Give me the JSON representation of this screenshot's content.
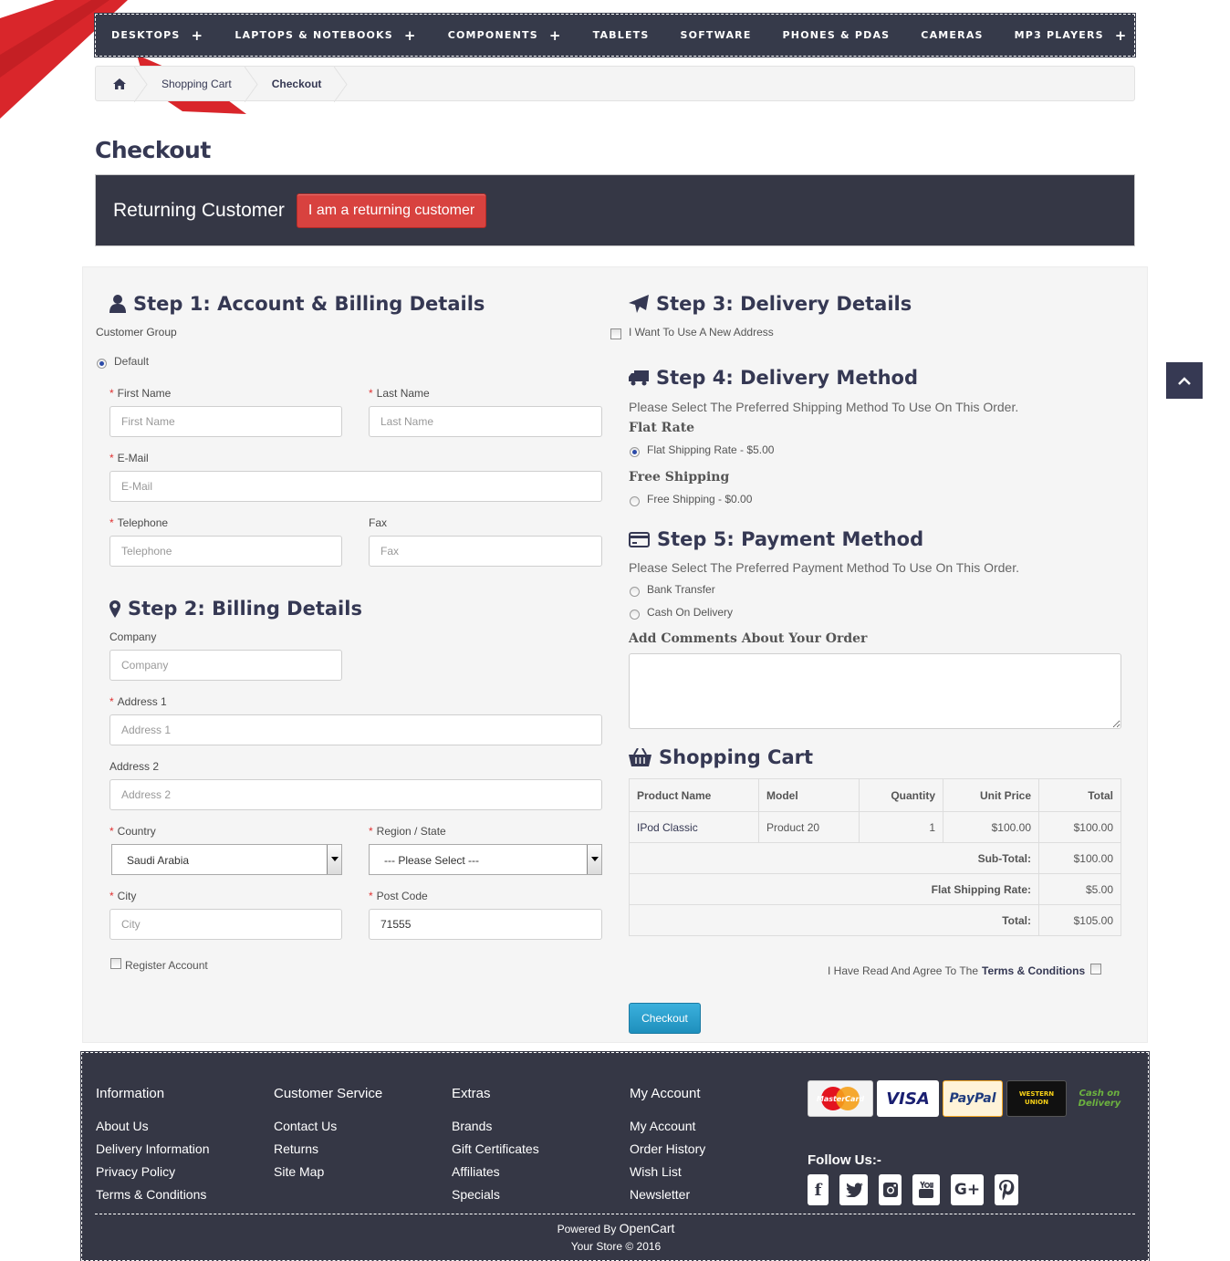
{
  "nav": {
    "items": [
      {
        "label": "DESKTOPS",
        "plus": "+"
      },
      {
        "label": "LAPTOPS & NOTEBOOKS",
        "plus": "+"
      },
      {
        "label": "COMPONENTS",
        "plus": "+"
      },
      {
        "label": "TABLETS",
        "plus": ""
      },
      {
        "label": "SOFTWARE",
        "plus": ""
      },
      {
        "label": "PHONES & PDAS",
        "plus": ""
      },
      {
        "label": "CAMERAS",
        "plus": ""
      },
      {
        "label": "MP3 PLAYERS",
        "plus": "+"
      }
    ]
  },
  "breadcrumb": {
    "home_icon": "home-icon",
    "items": [
      "Shopping Cart",
      "Checkout"
    ]
  },
  "page": {
    "title": "Checkout"
  },
  "returning": {
    "title": "Returning Customer",
    "button": "I am a returning customer"
  },
  "step1": {
    "title": "Step 1: Account & Billing Details",
    "customer_group_label": "Customer Group",
    "group_default": "Default",
    "first_name_label": "First Name",
    "first_name_ph": "First Name",
    "last_name_label": "Last Name",
    "last_name_ph": "Last Name",
    "email_label": "E-Mail",
    "email_ph": "E-Mail",
    "telephone_label": "Telephone",
    "telephone_ph": "Telephone",
    "fax_label": "Fax",
    "fax_ph": "Fax"
  },
  "step2": {
    "title": "Step 2: Billing Details",
    "company_label": "Company",
    "company_ph": "Company",
    "address1_label": "Address 1",
    "address1_ph": "Address 1",
    "address2_label": "Address 2",
    "address2_ph": "Address 2",
    "country_label": "Country",
    "country_value": "Saudi Arabia",
    "region_label": "Region / State",
    "region_value": " --- Please Select --- ",
    "city_label": "City",
    "city_ph": "City",
    "postcode_label": "Post Code",
    "postcode_value": "71555",
    "register_label": "Register Account"
  },
  "step3": {
    "title": "Step 3: Delivery Details",
    "new_address": "I Want To Use A New Address"
  },
  "step4": {
    "title": "Step 4: Delivery Method",
    "intro": "Please Select The Preferred Shipping Method To Use On This Order.",
    "flat_head": "Flat Rate",
    "flat_option": "Flat Shipping Rate - $5.00",
    "free_head": "Free Shipping",
    "free_option": "Free Shipping - $0.00"
  },
  "step5": {
    "title": "Step 5: Payment Method",
    "intro": "Please Select The Preferred Payment Method To Use On This Order.",
    "bank": "Bank Transfer",
    "cod": "Cash On Delivery",
    "comments_label": "Add Comments About Your Order"
  },
  "cart": {
    "title": "Shopping Cart",
    "headers": [
      "Product Name",
      "Model",
      "Quantity",
      "Unit Price",
      "Total"
    ],
    "row": {
      "name": "IPod Classic",
      "model": "Product 20",
      "qty": "1",
      "unit": "$100.00",
      "total": "$100.00"
    },
    "subtotal_label": "Sub-Total:",
    "subtotal": "$100.00",
    "shipping_label": "Flat  Shipping Rate:",
    "shipping": "$5.00",
    "total_label": "Total:",
    "total": "$105.00"
  },
  "agree": {
    "text": "I Have Read And Agree To The",
    "link": "Terms & Conditions"
  },
  "checkout_button": "Checkout",
  "footer": {
    "information": {
      "title": "Information",
      "links": [
        "About Us",
        "Delivery Information",
        "Privacy Policy",
        "Terms & Conditions"
      ]
    },
    "service": {
      "title": "Customer Service",
      "links": [
        "Contact Us",
        "Returns",
        "Site Map"
      ]
    },
    "extras": {
      "title": "Extras",
      "links": [
        "Brands",
        "Gift Certificates",
        "Affiliates",
        "Specials"
      ]
    },
    "account": {
      "title": "My Account",
      "links": [
        "My Account",
        "Order History",
        "Wish List",
        "Newsletter"
      ]
    },
    "payments": [
      "MasterCard",
      "VISA",
      "PayPal",
      "WESTERN UNION",
      "Cash on Delivery"
    ],
    "follow": "Follow Us:-",
    "socials": [
      "facebook-icon",
      "twitter-icon",
      "instagram-icon",
      "youtube-icon",
      "google-plus-icon",
      "pinterest-icon"
    ],
    "powered_prefix": "Powered By",
    "powered_name": "OpenCart",
    "copyright": "Your Store © 2016"
  },
  "colors": {
    "dark": "#353745",
    "accent_red": "#d8423f",
    "checkout_blue": "#2a9fd0",
    "link": "#353853"
  }
}
